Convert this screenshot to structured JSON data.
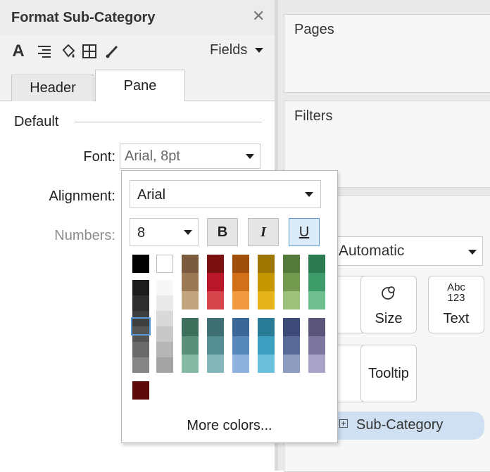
{
  "format_pane": {
    "title": "Format Sub-Category",
    "fields_label": "Fields",
    "tabs": [
      {
        "label": "Header"
      },
      {
        "label": "Pane"
      }
    ],
    "section_label": "Default",
    "rows": [
      {
        "label": "Font:",
        "value": "Arial, 8pt"
      },
      {
        "label": "Alignment:"
      },
      {
        "label": "Numbers:"
      }
    ]
  },
  "font_popup": {
    "family": "Arial",
    "size": "8",
    "bold_label": "B",
    "italic_label": "I",
    "underline_label": "U",
    "more_colors_label": "More colors...",
    "palette": {
      "black": "#000000",
      "white": "#ffffff",
      "gray_ramp": [
        "#1c1c1c",
        "#2e2e2e",
        "#3f3f3f",
        "#545454",
        "#6a6a6a",
        "#858585"
      ],
      "light_ramp": [
        "#f7f7f7",
        "#e9e9e9",
        "#d9d9d9",
        "#c8c8c8",
        "#b6b6b6",
        "#a4a4a4"
      ],
      "top_columns": [
        [
          "#7a5b3d",
          "#9a7954",
          "#c2a680"
        ],
        [
          "#7b1010",
          "#b8172a",
          "#d6444c"
        ],
        [
          "#a04f0a",
          "#d2701a",
          "#f29a3f"
        ],
        [
          "#9c7600",
          "#c69600",
          "#e5b41a"
        ],
        [
          "#537a3a",
          "#739a4e",
          "#9dc07a"
        ],
        [
          "#2c7a52",
          "#3d9c6a",
          "#6fbe8f"
        ]
      ],
      "bottom_columns": [
        [
          "#3e6e5c",
          "#5a9079",
          "#86b9a3"
        ],
        [
          "#3d6f73",
          "#558f94",
          "#84b5b8"
        ],
        [
          "#3b6796",
          "#5788bb",
          "#8db2dd"
        ],
        [
          "#2a7c96",
          "#3d9fbf",
          "#6cc0dc"
        ],
        [
          "#3d4a78",
          "#5a6a98",
          "#8e9cc0"
        ],
        [
          "#5a5478",
          "#7d77a0",
          "#a9a3c8"
        ]
      ],
      "recent": [
        "#5c0a0a"
      ]
    }
  },
  "shelves": {
    "pages_label": "Pages",
    "filters_label": "Filters",
    "mark_type": "Automatic",
    "buttons": [
      {
        "label": "Size"
      },
      {
        "label": "Text",
        "icon_text": "Abc\n123"
      },
      {
        "label": "Tooltip"
      }
    ],
    "detail_pill": "Sub-Category"
  }
}
